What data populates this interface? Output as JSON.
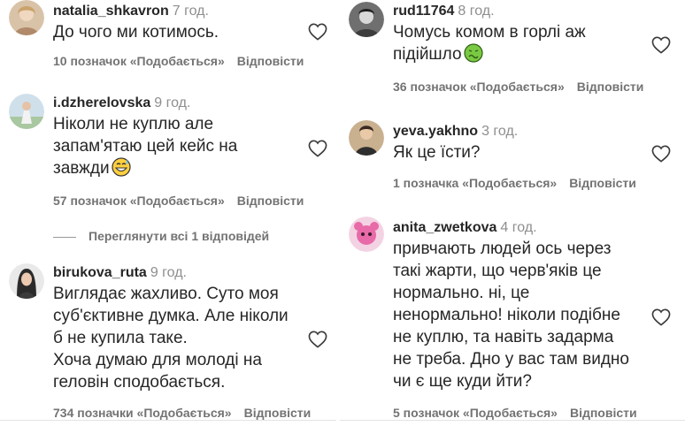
{
  "comments_left": [
    {
      "username": "natalia_shkavron",
      "time": "7 год.",
      "text": "До чого ми котимось.",
      "likes": "10 позначок «Подобається»",
      "reply": "Відповісти"
    },
    {
      "username": "i.dzherelovska",
      "time": "9 год.",
      "text": "Ніколи не куплю але\nзапам'ятаю цей кейс на\nзавжди",
      "likes": "57 позначок «Подобається»",
      "reply": "Відповісти",
      "view_replies": "Переглянути всі 1 відповідей"
    },
    {
      "username": "birukova_ruta",
      "time": "9 год.",
      "text": "Виглядає жахливо. Суто моя\nсуб'єктивне думка. Але ніколи\nб не купила таке.\nХоча думаю для молоді на\nгеловін сподобається.",
      "likes": "734 позначки «Подобається»",
      "reply": "Відповісти"
    }
  ],
  "comments_right": [
    {
      "username": "rud11764",
      "time": "8 год.",
      "text": "Чомусь комом в горлі аж\nпідійшло",
      "likes": "36 позначок «Подобається»",
      "reply": "Відповісти"
    },
    {
      "username": "yeva.yakhno",
      "time": "3 год.",
      "text": "Як це їсти?",
      "likes": "1 позначка «Подобається»",
      "reply": "Відповісти"
    },
    {
      "username": "anita_zwetkova",
      "time": "4 год.",
      "text": "привчають людей ось через\nтакі жарти, що черв'яків це\nнормально. ні, це\nненормально! ніколи подібне\nне куплю, та навіть задарма\nне треба. Дно у вас там видно\nчи є ще куди йти?",
      "likes": "5 позначок «Подобається»",
      "reply": "Відповісти"
    }
  ],
  "icons": {
    "like": "heart-outline-icon",
    "emoji_grin": "grinning-sweat-emoji",
    "emoji_sick": "nauseated-face-emoji"
  },
  "colors": {
    "text": "#262626",
    "muted": "#737373",
    "timestamp": "#8e8e8e",
    "divider": "#e3e3e3"
  }
}
